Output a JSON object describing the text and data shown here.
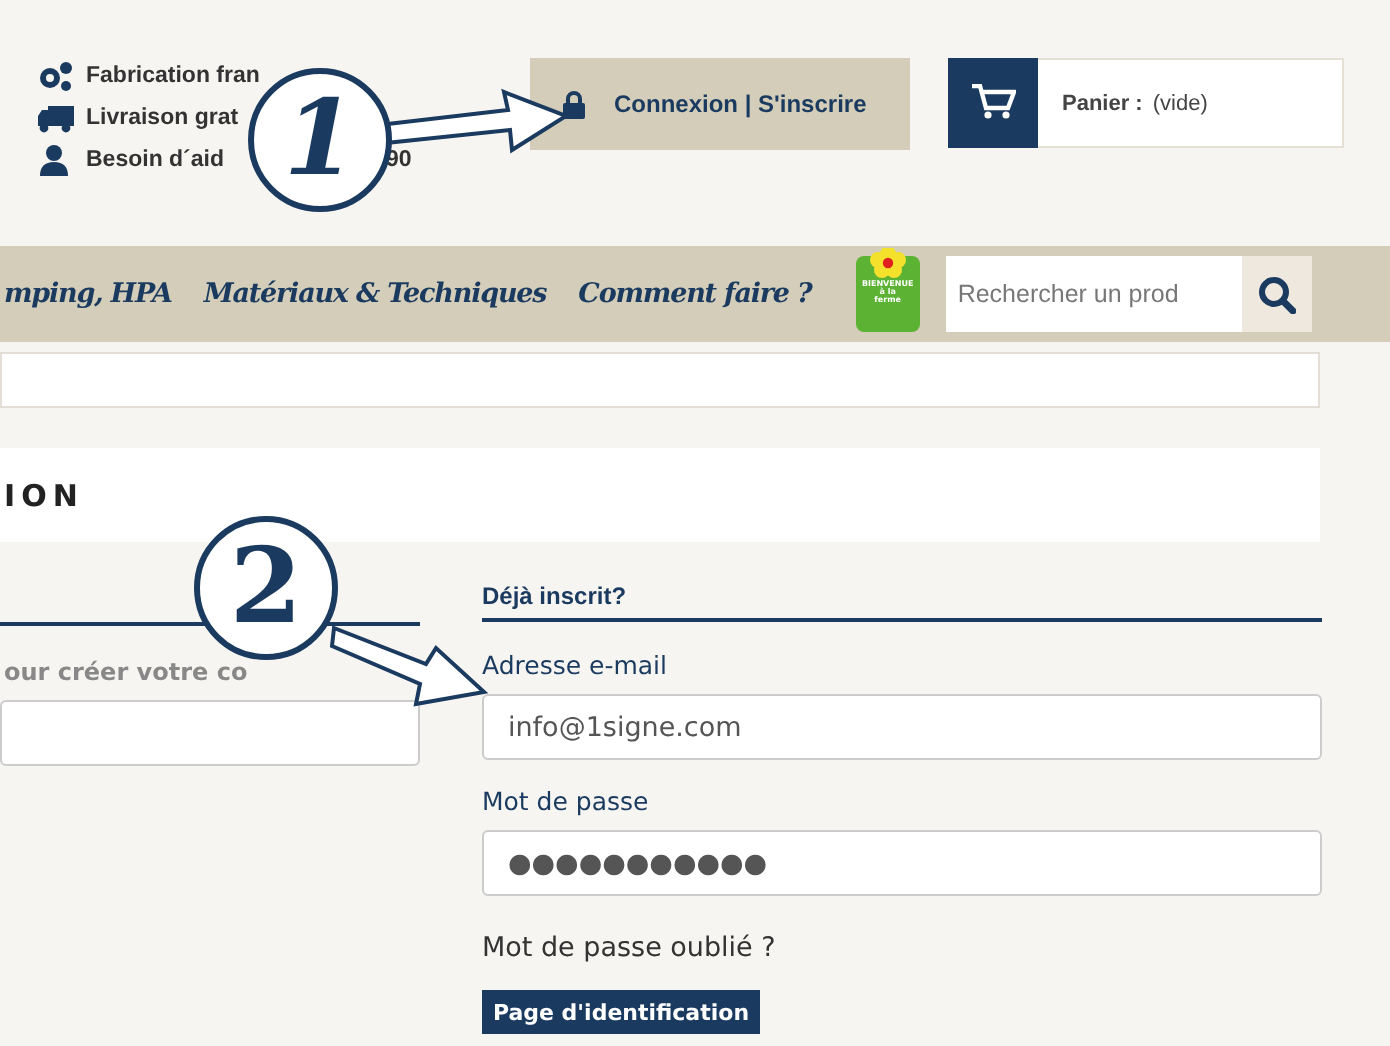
{
  "header_info": [
    {
      "text": "Fabrication fran"
    },
    {
      "text": "Livraison grat"
    },
    {
      "text": "Besoin d´aid",
      "tail": "90"
    }
  ],
  "account_button": {
    "label": "Connexion | S'inscrire"
  },
  "cart": {
    "label": "Panier :",
    "status": "(vide)"
  },
  "nav": {
    "items": [
      "mping, HPA",
      "Matériaux & Techniques",
      "Comment faire ?"
    ],
    "logo_text": [
      "BIENVENUE",
      "à la",
      "ferme"
    ],
    "search": {
      "placeholder": "Rechercher un prod"
    }
  },
  "section_title": "ION",
  "left_column": {
    "intro": "our créer votre co"
  },
  "login": {
    "heading": "Déjà inscrit?",
    "fields": [
      {
        "label": "Adresse e-mail",
        "value": "info@1signe.com"
      },
      {
        "label": "Mot de passe",
        "value": "●●●●●●●●●●●"
      }
    ],
    "forgot_link": "Mot de passe oublié ?",
    "submit": "Page d'identification"
  },
  "callouts": [
    {
      "number": "1"
    },
    {
      "number": "2"
    }
  ]
}
